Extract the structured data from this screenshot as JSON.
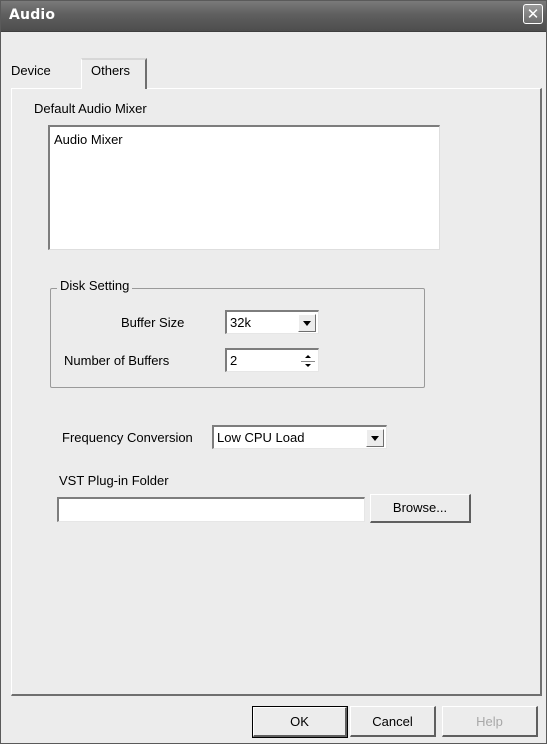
{
  "window": {
    "title": "Audio",
    "close_glyph": "✕"
  },
  "tabs": [
    {
      "label": "Device",
      "selected": false
    },
    {
      "label": "Others",
      "selected": true
    }
  ],
  "mixer": {
    "label": "Default Audio Mixer",
    "items": [
      "Audio Mixer"
    ]
  },
  "disk_setting": {
    "legend": "Disk Setting",
    "buffer_size_label": "Buffer Size",
    "buffer_size_value": "32k",
    "num_buffers_label": "Number of Buffers",
    "num_buffers_value": "2"
  },
  "frequency": {
    "label": "Frequency Conversion",
    "value": "Low CPU Load"
  },
  "vst": {
    "label": "VST Plug-in Folder",
    "value": "",
    "browse_label": "Browse..."
  },
  "buttons": {
    "ok": "OK",
    "cancel": "Cancel",
    "help": "Help"
  },
  "icons": {
    "close": "close-icon",
    "dropdown": "chevron-down-icon",
    "spin_up": "spin-up-icon",
    "spin_down": "spin-down-icon"
  }
}
